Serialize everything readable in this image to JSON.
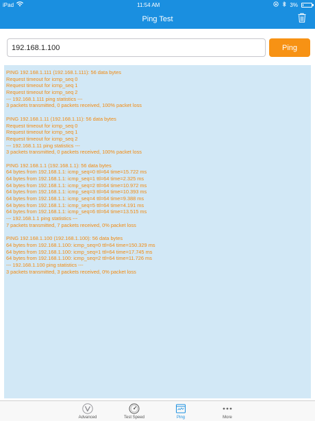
{
  "status_bar": {
    "device": "iPad",
    "time": "11:54 AM",
    "battery": "3%"
  },
  "nav": {
    "title": "Ping Test"
  },
  "input": {
    "value": "192.168.1.100",
    "button_label": "Ping"
  },
  "output": {
    "lines": [
      "PING 192.168.1.111 (192.168.1.111): 56 data bytes",
      "Request timeout for icmp_seq 0",
      "Request timeout for icmp_seq 1",
      "Request timeout for icmp_seq 2",
      "--- 192.168.1.111 ping statistics ---",
      "3 packets transmitted, 0 packets received, 100% packet loss",
      "",
      "PING 192.168.1.11 (192.168.1.11): 56 data bytes",
      "Request timeout for icmp_seq 0",
      "Request timeout for icmp_seq 1",
      "Request timeout for icmp_seq 2",
      "--- 192.168.1.11 ping statistics ---",
      "3 packets transmitted, 0 packets received, 100% packet loss",
      "",
      "PING 192.168.1.1 (192.168.1.1): 56 data bytes",
      "64 bytes from 192.168.1.1: icmp_seq=0 ttl=64 time=15.722 ms",
      "64 bytes from 192.168.1.1: icmp_seq=1 ttl=64 time=2.325 ms",
      "64 bytes from 192.168.1.1: icmp_seq=2 ttl=64 time=10.972 ms",
      "64 bytes from 192.168.1.1: icmp_seq=3 ttl=64 time=10.393 ms",
      "64 bytes from 192.168.1.1: icmp_seq=4 ttl=64 time=9.388 ms",
      "64 bytes from 192.168.1.1: icmp_seq=5 ttl=64 time=4.191 ms",
      "64 bytes from 192.168.1.1: icmp_seq=6 ttl=64 time=13.515 ms",
      "--- 192.168.1.1 ping statistics ---",
      "7 packets transmitted, 7 packets received, 0% packet loss",
      "",
      "PING 192.168.1.100 (192.168.1.100): 56 data bytes",
      "64 bytes from 192.168.1.100: icmp_seq=0 ttl=64 time=150.329 ms",
      "64 bytes from 192.168.1.100: icmp_seq=1 ttl=64 time=17.745 ms",
      "64 bytes from 192.168.1.100: icmp_seq=2 ttl=64 time=11.726 ms",
      "--- 192.168.1.100 ping statistics ---",
      "3 packets transmitted, 3 packets received, 0% packet loss"
    ]
  },
  "tabs": [
    {
      "label": "Advanced",
      "icon": "vine-icon",
      "active": false
    },
    {
      "label": "Test Speed",
      "icon": "speedometer-icon",
      "active": false
    },
    {
      "label": "Ping",
      "icon": "ping-window-icon",
      "active": true
    },
    {
      "label": "More",
      "icon": "more-dots-icon",
      "active": false
    }
  ],
  "colors": {
    "accent": "#1a8fe0",
    "button": "#f79214",
    "output_text": "#f18a10",
    "output_background": "#d2e8f6"
  }
}
